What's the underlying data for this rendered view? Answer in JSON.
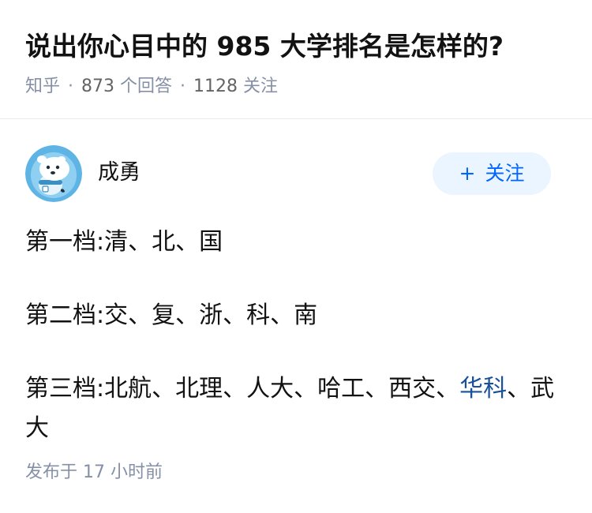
{
  "question": {
    "title": "说出你心目中的 985 大学排名是怎样的?",
    "meta": {
      "source": "知乎",
      "answers_count": "873",
      "answers_label": "个回答",
      "followers_count": "1128",
      "followers_label": "关注"
    }
  },
  "author": {
    "name": "成勇",
    "follow_label": "关注",
    "follow_icon": "plus-icon",
    "avatar_icon": "polar-bear-avatar"
  },
  "answer": {
    "paragraphs": [
      "第一档:清、北、国",
      "第二档:交、复、浙、科、南"
    ],
    "third": {
      "prefix": "第三档:北航、北理、人大、哈工、西交、",
      "link": "华科",
      "suffix": "、武大"
    }
  },
  "publish": {
    "label": "发布于",
    "time": "17 小时前"
  },
  "colors": {
    "accent": "#0066ff",
    "follow_bg": "#ebf5ff",
    "meta_gray": "#8590a6",
    "link": "#175199",
    "text": "#121212"
  }
}
